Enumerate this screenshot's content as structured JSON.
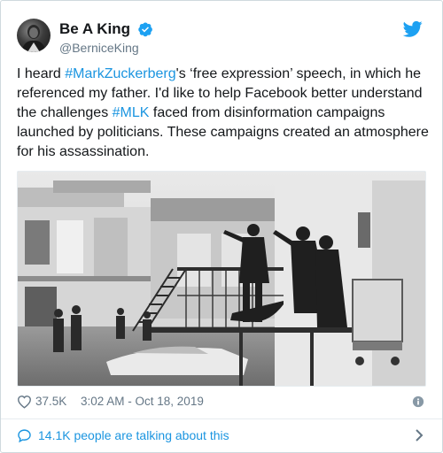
{
  "user": {
    "display_name": "Be A King",
    "handle": "@BerniceKing"
  },
  "icons": {
    "verified": "verified-badge-icon",
    "brand": "twitter-bird-icon",
    "like": "heart-icon",
    "info": "info-icon",
    "conversation": "speech-bubble-icon",
    "chevron": "chevron-right-icon"
  },
  "tweet": {
    "text_parts": {
      "p1": "I heard ",
      "hashtag1": "#MarkZuckerberg",
      "p2": "'s ‘free expression’ speech, in which he referenced my father. I'd like to help Facebook better understand the challenges ",
      "hashtag2": "#MLK",
      "p3": " faced from disinformation campaigns launched by politicians. These campaigns created an atmosphere for his assassination."
    }
  },
  "stats": {
    "likes": "37.5K",
    "timestamp": "3:02 AM - Oct 18, 2019"
  },
  "footer": {
    "talking": "14.1K people are talking about this"
  },
  "colors": {
    "link": "#1b95e0",
    "text": "#14171a",
    "secondary": "#657786",
    "border": "#e6ecf0"
  }
}
